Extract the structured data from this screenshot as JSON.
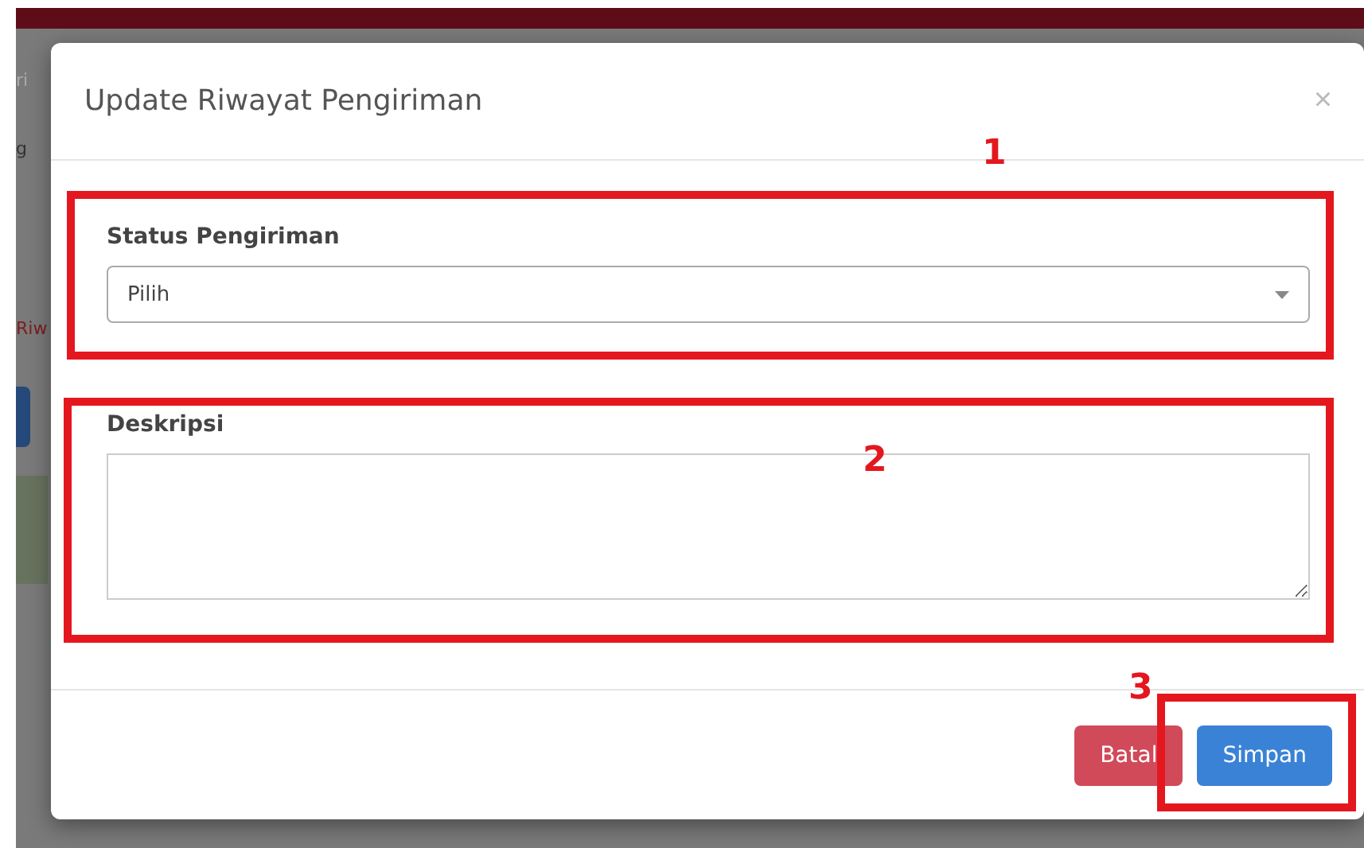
{
  "background_fragments": [
    "ri",
    "g",
    "Riw"
  ],
  "dialog": {
    "title": "Update Riwayat Pengiriman",
    "close": "×",
    "fields": [
      {
        "kind": "select",
        "label": "Status Pengiriman",
        "value": "Pilih"
      },
      {
        "kind": "textarea",
        "label": "Deskripsi"
      }
    ],
    "buttons": [
      {
        "label": "Batal",
        "kind": "danger"
      },
      {
        "label": "Simpan",
        "kind": "primary"
      }
    ]
  },
  "annotations": [
    {
      "label": "1"
    },
    {
      "label": "2"
    },
    {
      "label": "3"
    }
  ]
}
